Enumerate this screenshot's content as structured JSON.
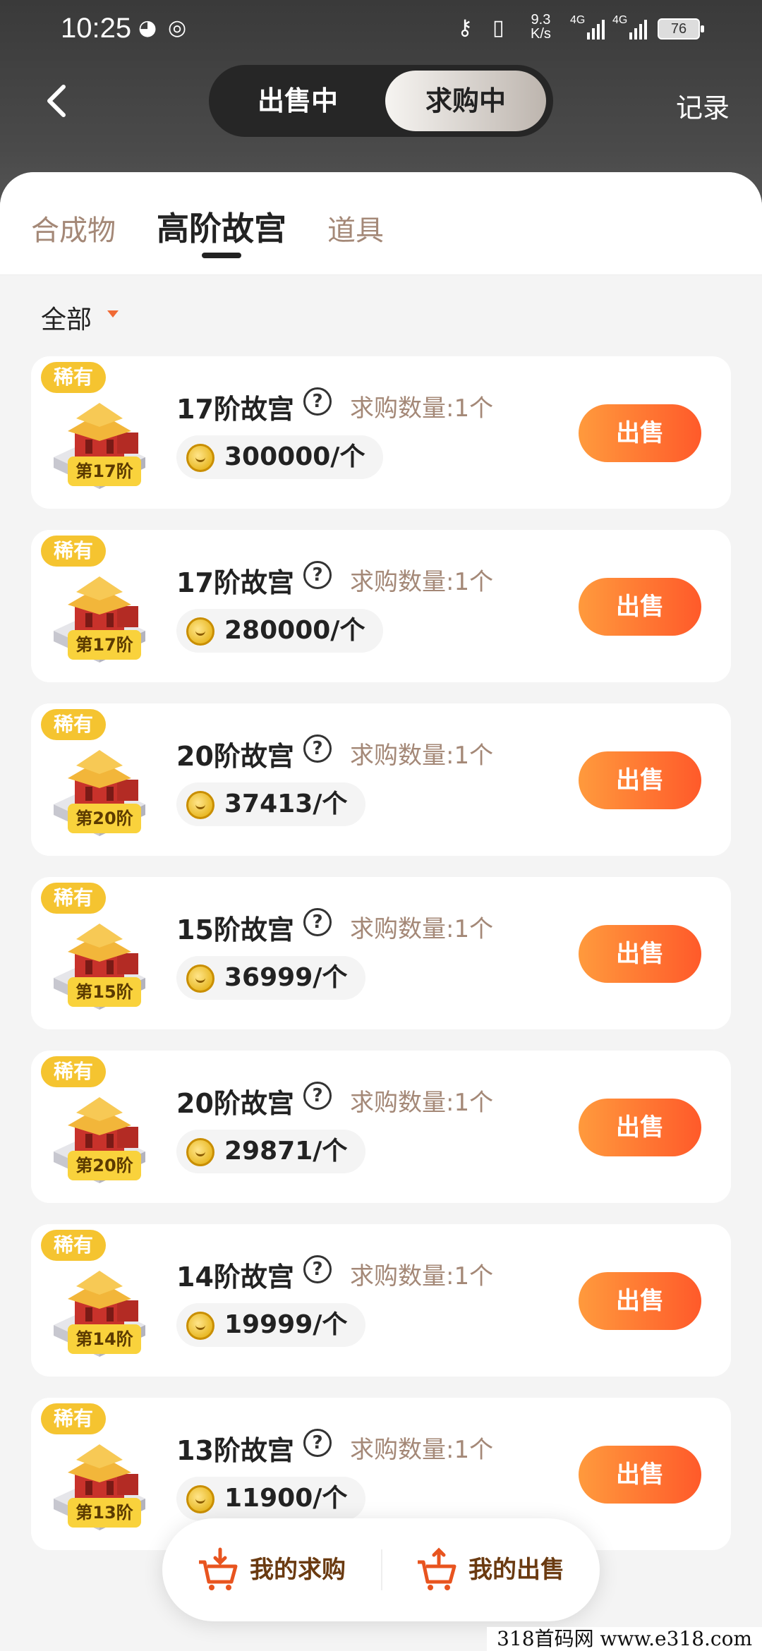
{
  "status_bar": {
    "time": "10:25",
    "net_speed_value": "9.3",
    "net_speed_unit": "K/s",
    "signal1": "4G",
    "signal2": "4G",
    "battery": "76"
  },
  "header": {
    "segment_sell": "出售中",
    "segment_buy": "求购中",
    "records": "记录"
  },
  "tabs": [
    "合成物",
    "高阶故宫",
    "道具"
  ],
  "filter": {
    "label": "全部"
  },
  "colors": {
    "accent_orange": "#ff6a2a",
    "rare_badge": "#f5c430",
    "tab_inactive": "#a48877"
  },
  "items": [
    {
      "badge": "稀有",
      "level": "第17阶",
      "name": "17阶故宫",
      "qty": "求购数量:1个",
      "price": "300000/个",
      "action": "出售"
    },
    {
      "badge": "稀有",
      "level": "第17阶",
      "name": "17阶故宫",
      "qty": "求购数量:1个",
      "price": "280000/个",
      "action": "出售"
    },
    {
      "badge": "稀有",
      "level": "第20阶",
      "name": "20阶故宫",
      "qty": "求购数量:1个",
      "price": "37413/个",
      "action": "出售"
    },
    {
      "badge": "稀有",
      "level": "第15阶",
      "name": "15阶故宫",
      "qty": "求购数量:1个",
      "price": "36999/个",
      "action": "出售"
    },
    {
      "badge": "稀有",
      "level": "第20阶",
      "name": "20阶故宫",
      "qty": "求购数量:1个",
      "price": "29871/个",
      "action": "出售"
    },
    {
      "badge": "稀有",
      "level": "第14阶",
      "name": "14阶故宫",
      "qty": "求购数量:1个",
      "price": "19999/个",
      "action": "出售"
    },
    {
      "badge": "稀有",
      "level": "第13阶",
      "name": "13阶故宫",
      "qty": "求购数量:1个",
      "price": "11900/个",
      "action": "出售"
    }
  ],
  "bottom_bar": {
    "my_requests": "我的求购",
    "my_sales": "我的出售"
  },
  "watermark": "318首码网  www.e318.com"
}
